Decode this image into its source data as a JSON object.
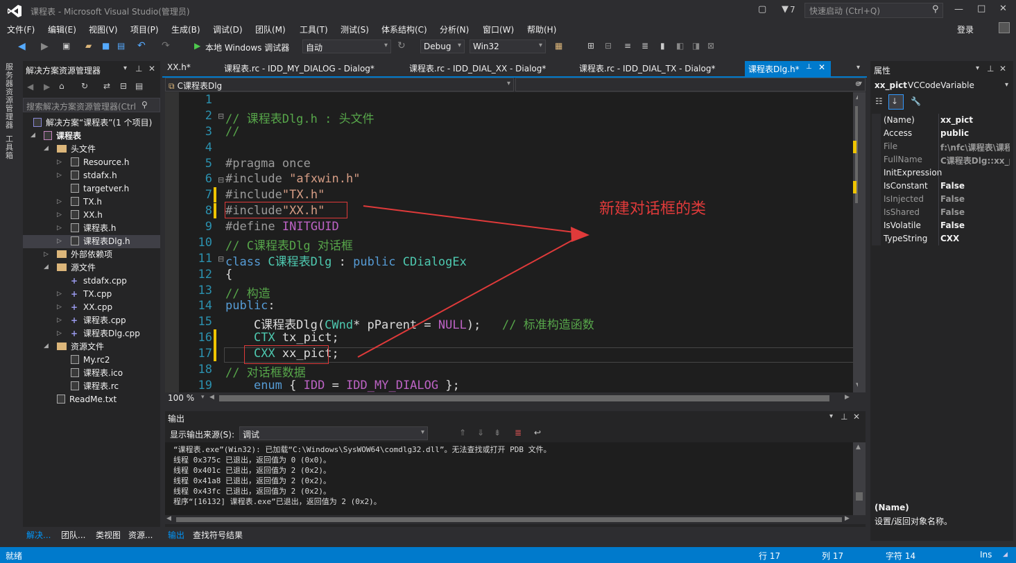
{
  "window": {
    "title": "课程表 - Microsoft Visual Studio(管理员)",
    "notif_count": "7",
    "quick_launch_placeholder": "快速启动 (Ctrl+Q)",
    "login": "登录"
  },
  "menu": [
    "文件(F)",
    "编辑(E)",
    "视图(V)",
    "项目(P)",
    "生成(B)",
    "调试(D)",
    "团队(M)",
    "工具(T)",
    "测试(S)",
    "体系结构(C)",
    "分析(N)",
    "窗口(W)",
    "帮助(H)"
  ],
  "toolbar": {
    "run_label": "本地 Windows 调试器",
    "config_auto": "自动",
    "config": "Debug",
    "platform": "Win32"
  },
  "left_strip": {
    "server": "服务器资源管理器",
    "toolbox": "工具箱"
  },
  "solution_explorer": {
    "title": "解决方案资源管理器",
    "search_placeholder": "搜索解决方案资源管理器(Ctrl",
    "solution": "解决方案“课程表”(1 个项目)",
    "project": "课程表",
    "headers_folder": "头文件",
    "headers": [
      "Resource.h",
      "stdafx.h",
      "targetver.h",
      "TX.h",
      "XX.h",
      "课程表.h",
      "课程表Dlg.h"
    ],
    "external": "外部依赖项",
    "source_folder": "源文件",
    "sources": [
      "stdafx.cpp",
      "TX.cpp",
      "XX.cpp",
      "课程表.cpp",
      "课程表Dlg.cpp"
    ],
    "resource_folder": "资源文件",
    "resources": [
      "My.rc2",
      "课程表.ico",
      "课程表.rc"
    ],
    "readme": "ReadMe.txt",
    "bottom_tabs": [
      "解决...",
      "团队...",
      "类视图",
      "资源..."
    ]
  },
  "editor": {
    "tabs": [
      "XX.h*",
      "课程表.rc - IDD_MY_DIALOG - Dialog*",
      "课程表.rc - IDD_DIAL_XX - Dialog*",
      "课程表.rc - IDD_DIAL_TX - Dialog*",
      "课程表Dlg.h*"
    ],
    "nav_class": "C课程表Dlg",
    "zoom": "100 %",
    "line_numbers": [
      "1",
      "2",
      "3",
      "4",
      "5",
      "6",
      "7",
      "8",
      "9",
      "10",
      "11",
      "12",
      "13",
      "14",
      "15",
      "16",
      "17",
      "18",
      "19"
    ],
    "annotation": "新建对话框的类"
  },
  "output": {
    "title": "输出",
    "source_label": "显示输出来源(S):",
    "source_value": "调试",
    "lines": [
      "“课程表.exe”(Win32): 已加载“C:\\Windows\\SysWOW64\\comdlg32.dll”。无法查找或打开 PDB 文件。",
      "线程 0x375c 已退出，返回值为 0 (0x0)。",
      "线程 0x401c 已退出，返回值为 2 (0x2)。",
      "线程 0x41a8 已退出，返回值为 2 (0x2)。",
      "线程 0x43fc 已退出，返回值为 2 (0x2)。",
      "程序“[16132] 课程表.exe”已退出，返回值为 2 (0x2)。"
    ],
    "bottom_tabs": [
      "输出",
      "查找符号结果"
    ]
  },
  "properties": {
    "title": "属性",
    "object_name": "xx_pict",
    "object_type": "VCCodeVariable",
    "rows": [
      {
        "k": "(Name)",
        "v": "xx_pict",
        "dim": false
      },
      {
        "k": "Access",
        "v": "public",
        "dim": false
      },
      {
        "k": "File",
        "v": "f:\\nfc\\课程表\\课程",
        "dim": true
      },
      {
        "k": "FullName",
        "v": "C课程表Dlg::xx_pi",
        "dim": true
      },
      {
        "k": "InitExpression",
        "v": "",
        "dim": false
      },
      {
        "k": "IsConstant",
        "v": "False",
        "dim": false
      },
      {
        "k": "IsInjected",
        "v": "False",
        "dim": true
      },
      {
        "k": "IsShared",
        "v": "False",
        "dim": true
      },
      {
        "k": "IsVolatile",
        "v": "False",
        "dim": false
      },
      {
        "k": "TypeString",
        "v": "CXX",
        "dim": false
      }
    ],
    "desc_title": "(Name)",
    "desc_text": "设置/返回对象名称。"
  },
  "status": {
    "ready": "就绪",
    "line": "行 17",
    "col": "列 17",
    "char": "字符 14",
    "mode": "Ins"
  },
  "colors": {
    "accent": "#007acc",
    "annotation": "#e03a3a"
  }
}
